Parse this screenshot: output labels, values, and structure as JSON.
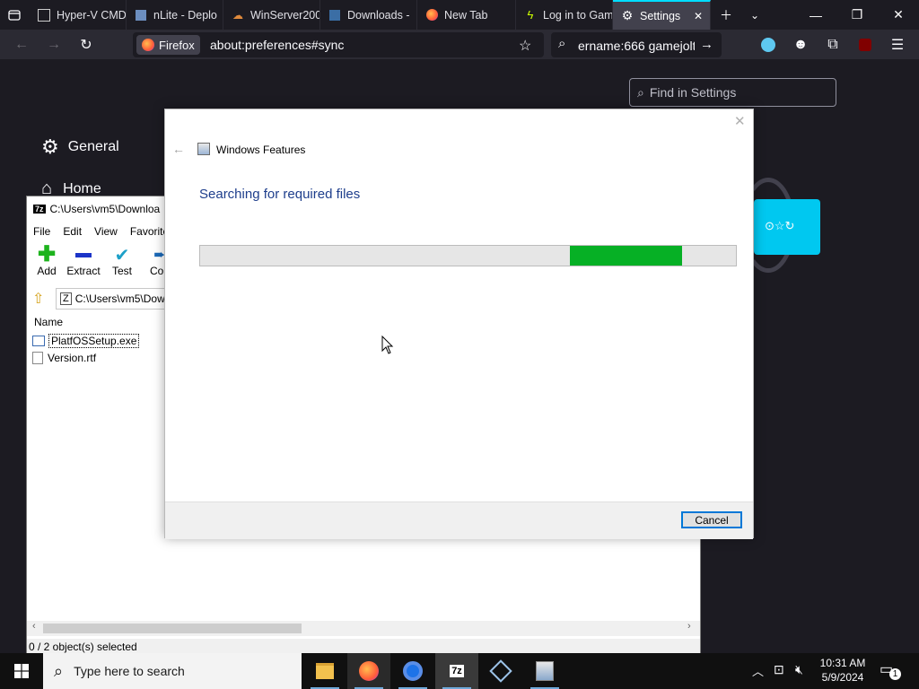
{
  "browser": {
    "tabs": [
      {
        "label": "Hyper-V CMD",
        "icon": "hyperv-icon"
      },
      {
        "label": "nLite - Deplo",
        "icon": "nlite-icon"
      },
      {
        "label": "WinServer200",
        "icon": "cloud-icon"
      },
      {
        "label": "Downloads -",
        "icon": "downloads-site-icon"
      },
      {
        "label": "New Tab",
        "icon": "firefox-icon"
      },
      {
        "label": "Log in to Gam",
        "icon": "gamejolt-icon"
      },
      {
        "label": "Settings",
        "icon": "gear-icon",
        "active": true
      }
    ],
    "identity_label": "Firefox",
    "url": "about:preferences#sync",
    "search_value": "ername:666 gamejolt"
  },
  "settings": {
    "find_placeholder": "Find in Settings",
    "nav": [
      {
        "label": "General",
        "icon": "gear-icon"
      },
      {
        "label": "Home",
        "icon": "home-icon"
      }
    ]
  },
  "sevenzip": {
    "title": "C:\\Users\\vm5\\Downloa",
    "menu": [
      "File",
      "Edit",
      "View",
      "Favorite"
    ],
    "toolbar": [
      "Add",
      "Extract",
      "Test",
      "Cop"
    ],
    "path": "C:\\Users\\vm5\\Dow",
    "column_name": "Name",
    "files": [
      {
        "name": "PlatfOSSetup.exe",
        "icon": "exe-file-icon"
      },
      {
        "name": "Version.rtf",
        "icon": "rtf-file-icon"
      }
    ],
    "status": "0 / 2 object(s) selected"
  },
  "dialog": {
    "title": "Windows Features",
    "heading": "Searching for required files",
    "cancel_label": "Cancel",
    "progress_segment": {
      "start": 0.69,
      "end": 0.9
    }
  },
  "taskbar": {
    "search_placeholder": "Type here to search",
    "time": "10:31 AM",
    "date": "5/9/2024",
    "notification_count": "1"
  },
  "colors": {
    "accent": "#00ddff",
    "progress_green": "#06b025",
    "dialog_heading": "#1e3e8c"
  }
}
